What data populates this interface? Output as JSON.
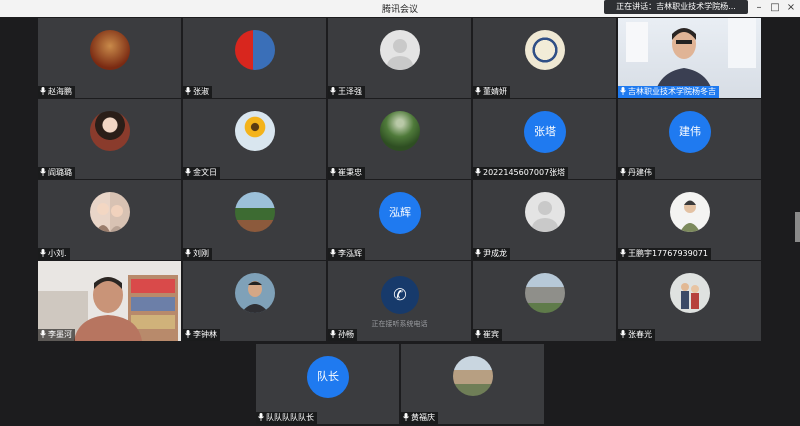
{
  "window": {
    "title": "腾讯会议",
    "speaking": "正在讲话：吉林职业技术学院杨..."
  },
  "colors": {
    "initials_bg": "#1f7af0",
    "tile_bg": "#3b3c3f",
    "background": "#1c1c1e"
  },
  "phone_status": "正在接听系统电话",
  "participants": [
    {
      "name": "赵海鹏",
      "avatar_icon": "dining-room-photo"
    },
    {
      "name": "张淑",
      "avatar_icon": "flag-photo"
    },
    {
      "name": "王泽强",
      "avatar_icon": "default-avatar-icon"
    },
    {
      "name": "董婧妍",
      "avatar_icon": "emblem-photo"
    },
    {
      "name": "吉林职业技术学院杨冬吉",
      "avatar_icon": "camera-video-man"
    },
    {
      "name": "阎璐璐",
      "avatar_icon": "woman-portrait-photo"
    },
    {
      "name": "金文日",
      "avatar_icon": "sunflower-photo"
    },
    {
      "name": "崔秉忠",
      "avatar_icon": "forest-photo"
    },
    {
      "name": "2022145607007张塔",
      "initials": "张塔"
    },
    {
      "name": "丹建伟",
      "initials": "建伟"
    },
    {
      "name": "小刘.",
      "avatar_icon": "children-photo"
    },
    {
      "name": "刘刚",
      "avatar_icon": "tree-photo"
    },
    {
      "name": "李泓辉",
      "initials": "泓辉"
    },
    {
      "name": "尹成龙",
      "avatar_icon": "default-avatar-icon"
    },
    {
      "name": "王鹏宇17767939071",
      "avatar_icon": "person-cartoon-photo"
    },
    {
      "name": "李墨河",
      "avatar_icon": "camera-video-man-bookshelf"
    },
    {
      "name": "李钟林",
      "avatar_icon": "man-portrait-photo"
    },
    {
      "name": "孙畅",
      "avatar_icon": "phone-icon"
    },
    {
      "name": "崔宾",
      "avatar_icon": "building-photo"
    },
    {
      "name": "张春光",
      "avatar_icon": "people-photo"
    },
    {
      "name": "队队队队队长",
      "initials": "队长"
    },
    {
      "name": "黄福庆",
      "avatar_icon": "rock-photo"
    }
  ]
}
